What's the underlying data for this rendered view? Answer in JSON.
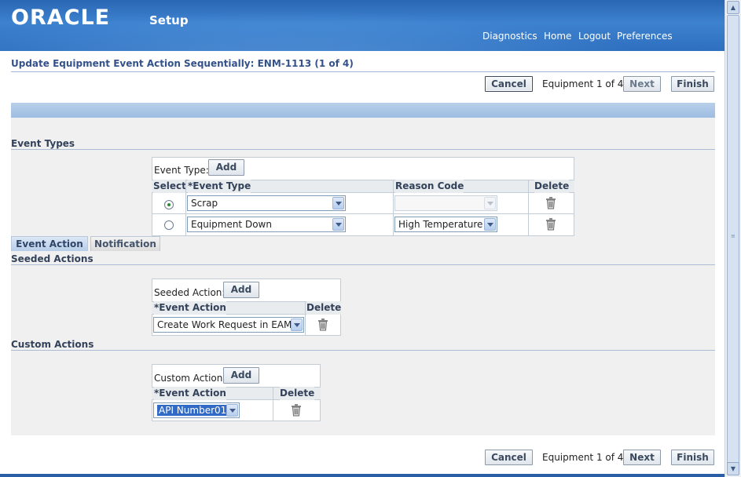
{
  "header": {
    "logo": "ORACLE",
    "app_name": "Setup",
    "nav": [
      "Diagnostics",
      "Home",
      "Logout",
      "Preferences"
    ]
  },
  "page": {
    "title": "Update Equipment Event Action Sequentially: ENM-1113 (1 of 4)"
  },
  "train": {
    "cancel": "Cancel",
    "position": "Equipment 1 of 4",
    "next": "Next",
    "finish": "Finish"
  },
  "event_types": {
    "section_title": "Event Types",
    "add_label": "Event Type:",
    "add_button": "Add",
    "columns": [
      "Select",
      "*Event Type",
      "Reason Code",
      "Delete"
    ],
    "rows": [
      {
        "selected": true,
        "event_type": "Scrap",
        "reason_code": ""
      },
      {
        "selected": false,
        "event_type": "Equipment Down",
        "reason_code": "High Temperature"
      }
    ]
  },
  "tabs": [
    "Event Action",
    "Notification"
  ],
  "seeded_actions": {
    "section_title": "Seeded Actions",
    "add_label": "Seeded Action:",
    "add_button": "Add",
    "columns": [
      "*Event Action",
      "Delete"
    ],
    "rows": [
      {
        "event_action": "Create Work Request in EAM"
      }
    ]
  },
  "custom_actions": {
    "section_title": "Custom Actions",
    "add_label": "Custom Action:",
    "add_button": "Add",
    "columns": [
      "*Event Action",
      "Delete"
    ],
    "rows": [
      {
        "event_action": "API Number01"
      }
    ]
  },
  "colors": {
    "header_blue": "#2e6fbf",
    "title_blue": "#33518a",
    "selection_blue": "#316ac5"
  }
}
